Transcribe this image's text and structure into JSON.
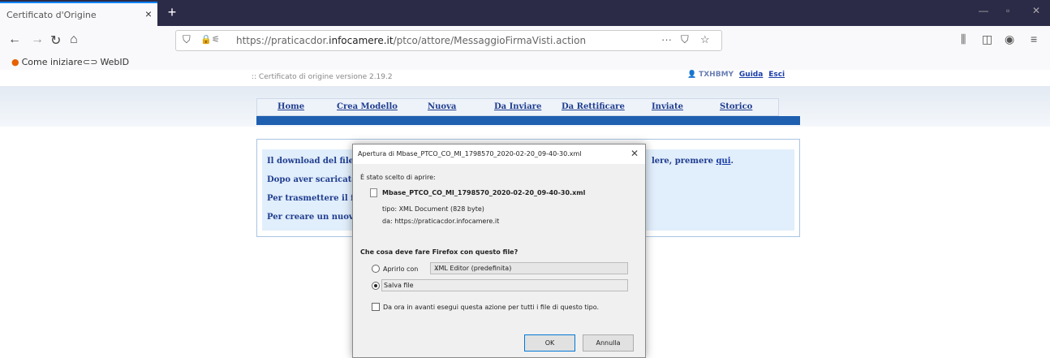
{
  "browser": {
    "tab_title": "Certificato d'Origine",
    "url_prefix": "https://praticacdor.",
    "url_domain": "infocamere.it",
    "url_path": "/ptco/attore/MessaggioFirmaVisti.action",
    "url_more": "···",
    "bookmarks": [
      {
        "label": "Come iniziare",
        "icon": "firefox-icon"
      },
      {
        "label": "WebID",
        "icon": "webid-icon"
      }
    ]
  },
  "page": {
    "version": ":: Certificato di origine versione 2.19.2",
    "user": "TXHBMY",
    "help_link": "Guida",
    "exit_link": "Esci",
    "menu": [
      "Home",
      "Crea Modello",
      "Nuova",
      "Da Inviare",
      "Da Rettificare",
      "Inviate",
      "Storico"
    ],
    "lines": [
      {
        "text": "Il download del file",
        "tail": "lere, premere ",
        "link": "qui",
        "end": "."
      },
      {
        "text": "Dopo aver scaricato"
      },
      {
        "text": "Per trasmettere il f"
      },
      {
        "text": "Per creare un nuov"
      }
    ]
  },
  "dialog": {
    "title": "Apertura di Mbase_PTCO_CO_MI_1798570_2020-02-20_09-40-30.xml",
    "chosen_label": "È stato scelto di aprire:",
    "file_name": "Mbase_PTCO_CO_MI_1798570_2020-02-20_09-40-30.xml",
    "type_line": "tipo: XML Document (828 byte)",
    "from_line": "da: https://praticacdor.infocamere.it",
    "question": "Che cosa deve fare Firefox con questo file?",
    "open_with_label": "Aprirlo con",
    "open_with_value": "XML Editor (predefinita)",
    "save_label": "Salva file",
    "checkbox_label": "Da ora in avanti esegui questa azione per tutti i file di questo tipo.",
    "selected_option": "save",
    "ok": "OK",
    "cancel": "Annulla"
  }
}
